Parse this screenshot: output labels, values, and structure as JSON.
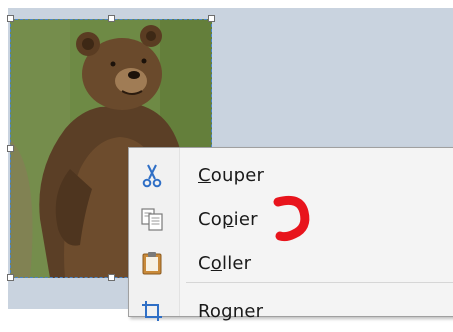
{
  "menu": {
    "items": [
      {
        "pre": "",
        "key": "C",
        "post": "ouper",
        "icon": "scissors-icon"
      },
      {
        "pre": "Co",
        "key": "p",
        "post": "ier",
        "icon": "copy-icon"
      },
      {
        "pre": "C",
        "key": "o",
        "post": "ller",
        "icon": "clipboard-icon"
      },
      {
        "pre": "Rogner",
        "key": "",
        "post": "",
        "icon": "crop-icon"
      }
    ]
  },
  "colors": {
    "workspace": "#c9d3df",
    "selection_border": "#4a84c8",
    "annotation": "#e8141c",
    "icon_blue": "#2f6fc6"
  }
}
